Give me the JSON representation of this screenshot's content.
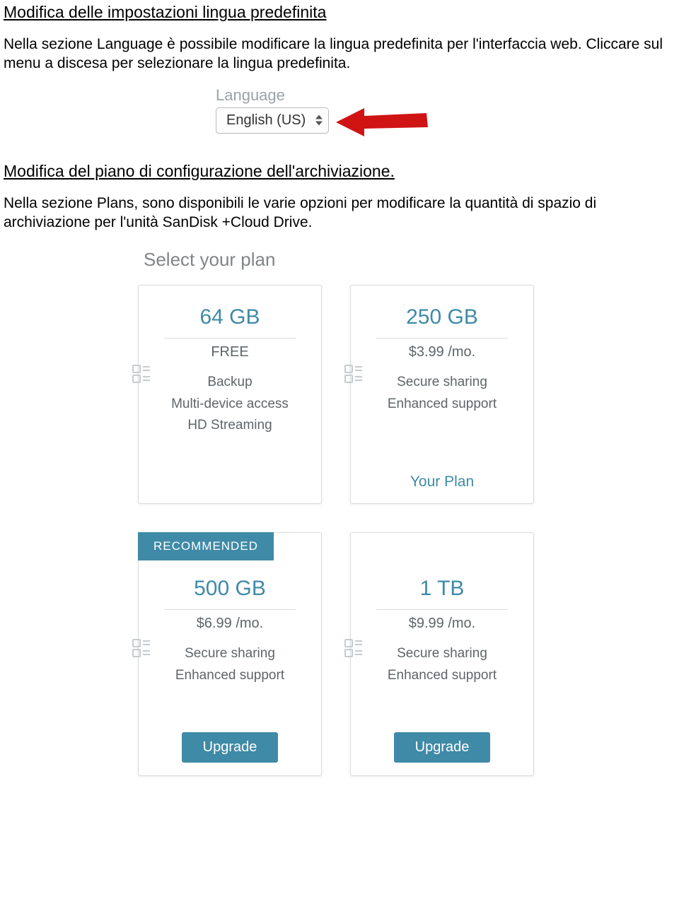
{
  "section1": {
    "heading": "Modifica delle impostazioni lingua predefinita",
    "paragraph": "Nella sezione Language è possibile modificare la lingua predefinita per l'interfaccia web. Cliccare sul menu a discesa per selezionare la lingua predefinita."
  },
  "language_widget": {
    "label": "Language",
    "value": "English (US)"
  },
  "section2": {
    "heading": "Modifica del piano di configurazione dell'archiviazione.",
    "paragraph": "Nella sezione Plans, sono disponibili le varie opzioni per modificare la quantità di spazio di archiviazione per l'unità SanDisk +Cloud Drive."
  },
  "plans": {
    "title": "Select your plan",
    "recommended_label": "RECOMMENDED",
    "your_plan_label": "Your Plan",
    "upgrade_label": "Upgrade",
    "cards": [
      {
        "size": "64 GB",
        "price": "FREE",
        "features": [
          "Backup",
          "Multi-device access",
          "HD Streaming"
        ],
        "state": "none"
      },
      {
        "size": "250 GB",
        "price": "$3.99 /mo.",
        "features": [
          "Secure sharing",
          "Enhanced support"
        ],
        "state": "current"
      },
      {
        "size": "500 GB",
        "price": "$6.99 /mo.",
        "features": [
          "Secure sharing",
          "Enhanced support"
        ],
        "state": "recommended_upgrade"
      },
      {
        "size": "1 TB",
        "price": "$9.99 /mo.",
        "features": [
          "Secure sharing",
          "Enhanced support"
        ],
        "state": "upgrade"
      }
    ]
  }
}
